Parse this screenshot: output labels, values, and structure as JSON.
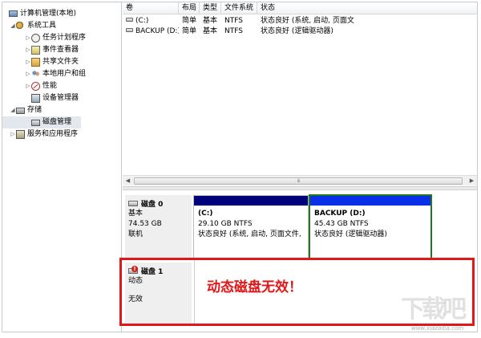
{
  "tree": {
    "root": "计算机管理(本地)",
    "system_tools": "系统工具",
    "task_scheduler": "任务计划程序",
    "event_viewer": "事件查看器",
    "shared_folders": "共享文件夹",
    "local_users": "本地用户和组",
    "performance": "性能",
    "device_manager": "设备管理器",
    "storage": "存储",
    "disk_management": "磁盘管理",
    "services_apps": "服务和应用程序"
  },
  "volume_list": {
    "columns": [
      "卷",
      "布局",
      "类型",
      "文件系统",
      "状态"
    ],
    "rows": [
      [
        "(C:)",
        "简单",
        "基本",
        "NTFS",
        "状态良好 (系统, 启动, 页面文"
      ],
      [
        "BACKUP (D:)",
        "简单",
        "基本",
        "NTFS",
        "状态良好 (逻辑驱动器)"
      ]
    ]
  },
  "scrollbar": {
    "grip": "⁞⁞⁞"
  },
  "disk0": {
    "name": "磁盘 0",
    "type": "基本",
    "size": "74.53 GB",
    "status": "联机",
    "partitions": [
      {
        "name": "(C:)",
        "size": "29.10 GB NTFS",
        "status": "状态良好 (系统, 启动, 页面文件, 活"
      },
      {
        "name": "BACKUP  (D:)",
        "size": "45.43 GB NTFS",
        "status": "状态良好 (逻辑驱动器)"
      }
    ]
  },
  "disk1": {
    "name": "磁盘 1",
    "type": "动态",
    "status": "无效"
  },
  "annotation": "动态磁盘无效！",
  "watermark": {
    "logo": "下载吧",
    "url": "www.xiazaiba.com"
  },
  "colors": {
    "partition_bar": "#00007a",
    "partition_bar_selected": "#0a2fe8",
    "selected_border": "#1f7a1f",
    "highlight": "#e01818"
  },
  "icons": {
    "root": "computer-icon",
    "system_tools": "tools-icon",
    "task_scheduler": "clock-icon",
    "event_viewer": "event-log-icon",
    "shared_folders": "shared-folder-icon",
    "local_users": "users-icon",
    "performance": "performance-icon",
    "device_manager": "device-manager-icon",
    "storage": "storage-icon",
    "disk_management": "disk-icon",
    "services_apps": "services-icon"
  }
}
